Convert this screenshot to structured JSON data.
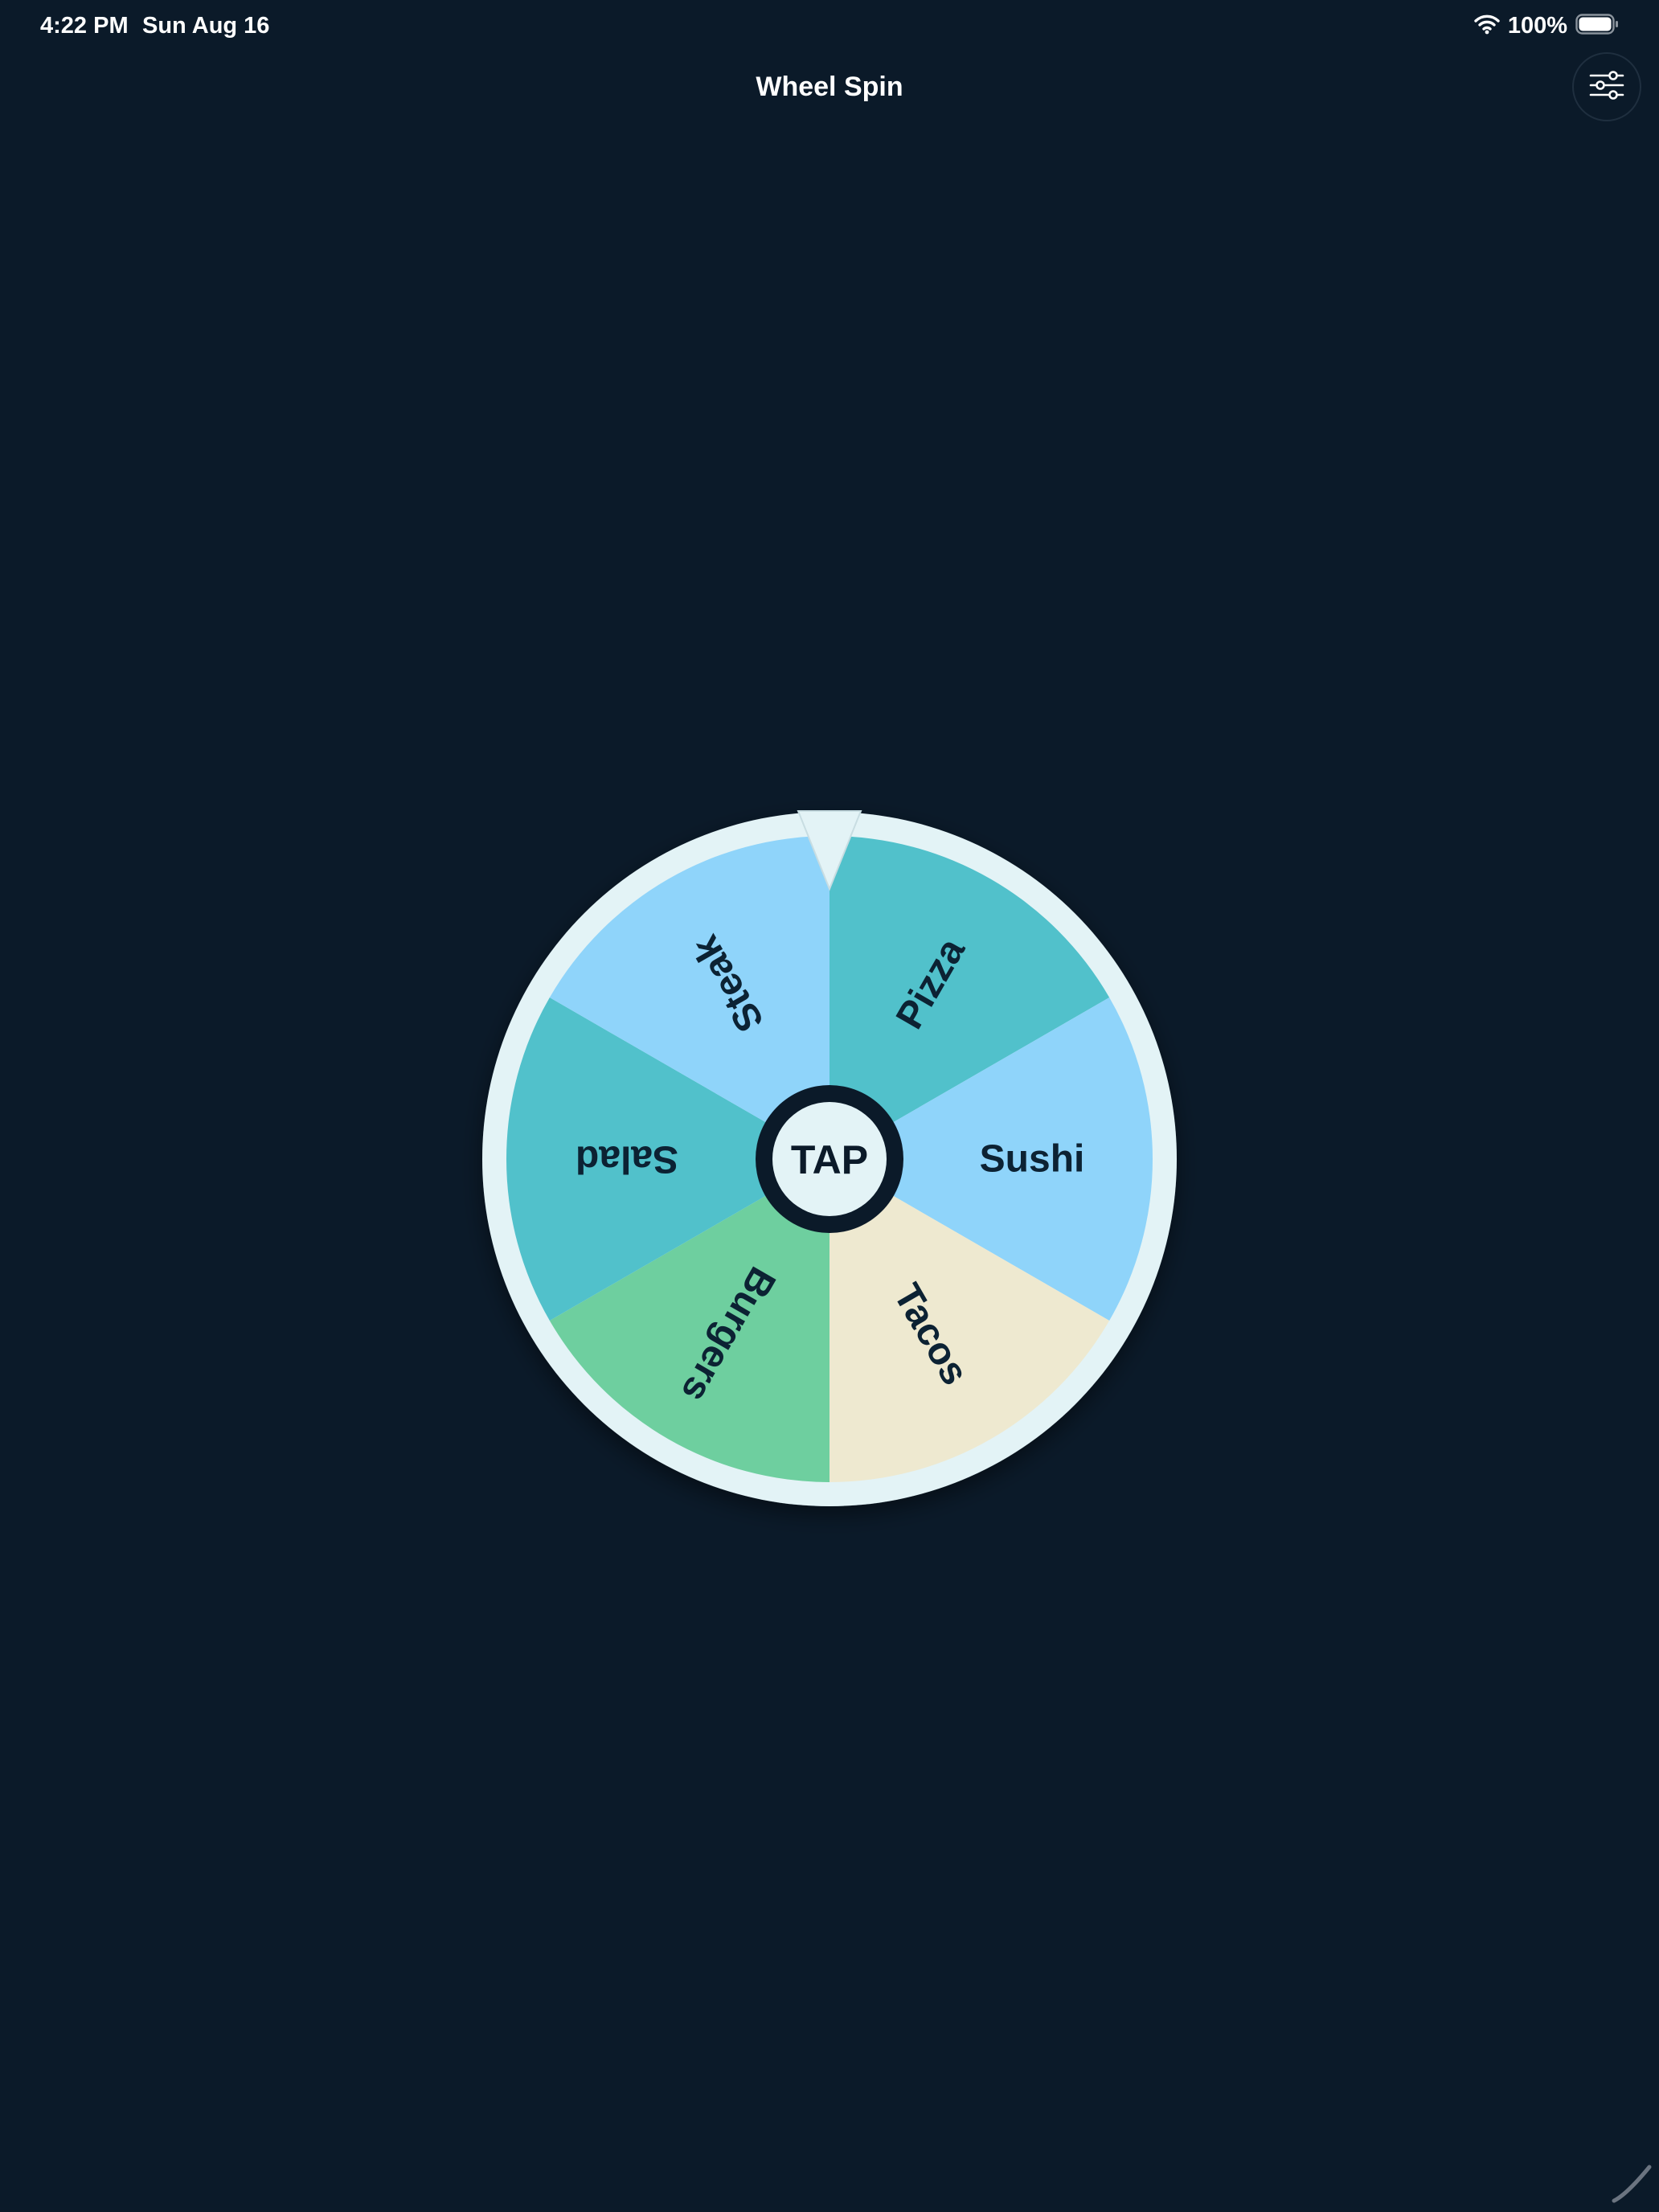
{
  "status_bar": {
    "time": "4:22 PM",
    "date": "Sun Aug 16",
    "battery_percent": "100%",
    "wifi_icon": "wifi-icon",
    "battery_icon": "battery-icon"
  },
  "nav": {
    "title": "Wheel Spin",
    "settings_icon": "sliders-icon"
  },
  "wheel": {
    "center_label": "TAP",
    "pointer_icon": "pointer-triangle-icon",
    "segments": [
      {
        "label": "Pizza",
        "color": "#51c1cb"
      },
      {
        "label": "Sushi",
        "color": "#8fd4fa"
      },
      {
        "label": "Tacos",
        "color": "#eee9d0"
      },
      {
        "label": "Burgers",
        "color": "#6ecf9f"
      },
      {
        "label": "Salad",
        "color": "#51c1cb"
      },
      {
        "label": "Steak",
        "color": "#8fd4fa"
      }
    ],
    "rim_color": "#e3f3f6",
    "hub_ring_color": "#0b1a29"
  },
  "colors": {
    "background": "#0b1a29",
    "label_text": "#0c2233"
  }
}
